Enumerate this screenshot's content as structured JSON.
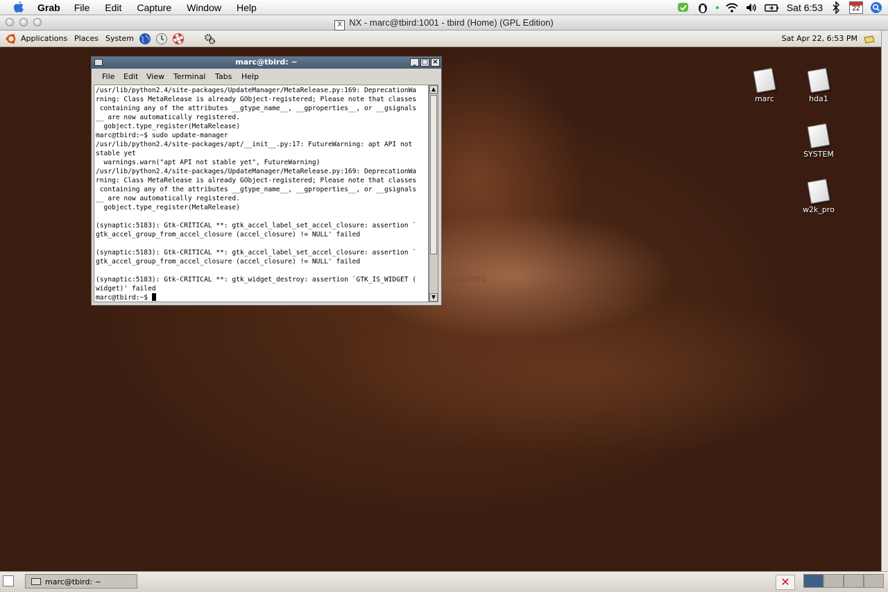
{
  "mac_menubar": {
    "app_name": "Grab",
    "menus": [
      "File",
      "Edit",
      "Capture",
      "Window",
      "Help"
    ],
    "clock": "Sat 6:53",
    "calendar_day": "22"
  },
  "nx_window": {
    "title": "NX - marc@tbird:1001 - tbird (Home) (GPL Edition)",
    "x_label": "X"
  },
  "gnome_panel": {
    "menus": [
      "Applications",
      "Places",
      "System"
    ],
    "clock": "Sat Apr 22,  6:53 PM"
  },
  "desktop": {
    "watermark": "ubuntu",
    "icons": [
      {
        "label": "marc"
      },
      {
        "label": "hda1"
      },
      {
        "label": "SYSTEM"
      },
      {
        "label": "w2k_pro"
      }
    ]
  },
  "terminal": {
    "title": "marc@tbird: ~",
    "menus": [
      "File",
      "Edit",
      "View",
      "Terminal",
      "Tabs",
      "Help"
    ],
    "lines": [
      "/usr/lib/python2.4/site-packages/UpdateManager/MetaRelease.py:169: DeprecationWa",
      "rning: Class MetaRelease is already GObject-registered; Please note that classes",
      " containing any of the attributes __gtype_name__, __gproperties__, or __gsignals",
      "__ are now automatically registered.",
      "  gobject.type_register(MetaRelease)",
      "marc@tbird:~$ sudo update-manager",
      "/usr/lib/python2.4/site-packages/apt/__init__.py:17: FutureWarning: apt API not",
      "stable yet",
      "  warnings.warn(\"apt API not stable yet\", FutureWarning)",
      "/usr/lib/python2.4/site-packages/UpdateManager/MetaRelease.py:169: DeprecationWa",
      "rning: Class MetaRelease is already GObject-registered; Please note that classes",
      " containing any of the attributes __gtype_name__, __gproperties__, or __gsignals",
      "__ are now automatically registered.",
      "  gobject.type_register(MetaRelease)",
      "",
      "(synaptic:5183): Gtk-CRITICAL **: gtk_accel_label_set_accel_closure: assertion `",
      "gtk_accel_group_from_accel_closure (accel_closure) != NULL' failed",
      "",
      "(synaptic:5183): Gtk-CRITICAL **: gtk_accel_label_set_accel_closure: assertion `",
      "gtk_accel_group_from_accel_closure (accel_closure) != NULL' failed",
      "",
      "(synaptic:5183): Gtk-CRITICAL **: gtk_widget_destroy: assertion `GTK_IS_WIDGET (",
      "widget)' failed"
    ],
    "prompt": "marc@tbird:~$ "
  },
  "bottom_panel": {
    "task_label": "marc@tbird: ~"
  },
  "icons": {
    "apple": "apple-icon",
    "ubuntu": "ubuntu-logo-icon",
    "browser": "globe-icon",
    "email": "mail-clock-icon",
    "help": "lifebuoy-icon",
    "applet": "gears-icon",
    "notes": "notes-icon",
    "trash": "close-x-icon"
  },
  "colors": {
    "terminal_title": "#4f6680",
    "desktop": "#3b1f12"
  }
}
